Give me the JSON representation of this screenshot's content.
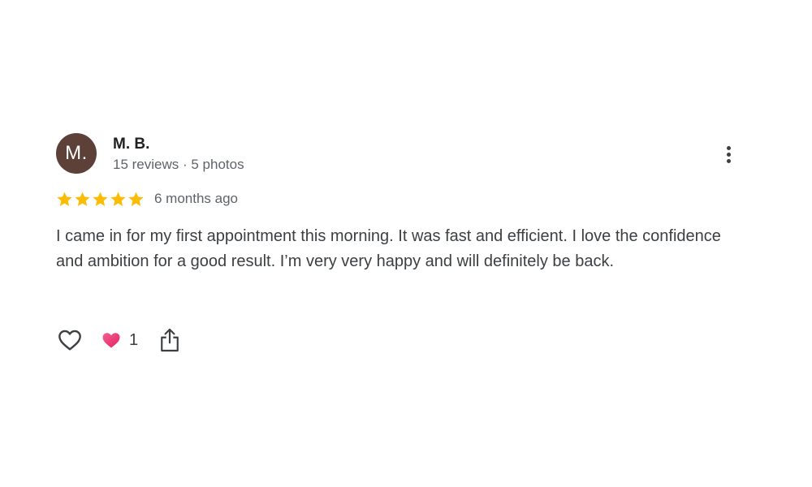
{
  "review": {
    "author": {
      "initial": "M.",
      "name": "M. B.",
      "meta": "15 reviews · 5 photos",
      "avatar_color": "#5d4037"
    },
    "rating": {
      "stars": 5,
      "max_stars": 5,
      "star_color": "#fbbc04"
    },
    "date": "6 months ago",
    "text": "I came in for my first appointment this morning. It was fast and efficient. I love the confidence and ambition for a good result. I’m very very happy and will definitely be back.",
    "actions": {
      "like_icon": "heart-outline-icon",
      "reaction_icon": "heart-filled-icon",
      "reaction_color": "#ea4c7a",
      "reaction_count": "1",
      "share_icon": "share-icon",
      "more_icon": "more-vert-icon"
    }
  }
}
